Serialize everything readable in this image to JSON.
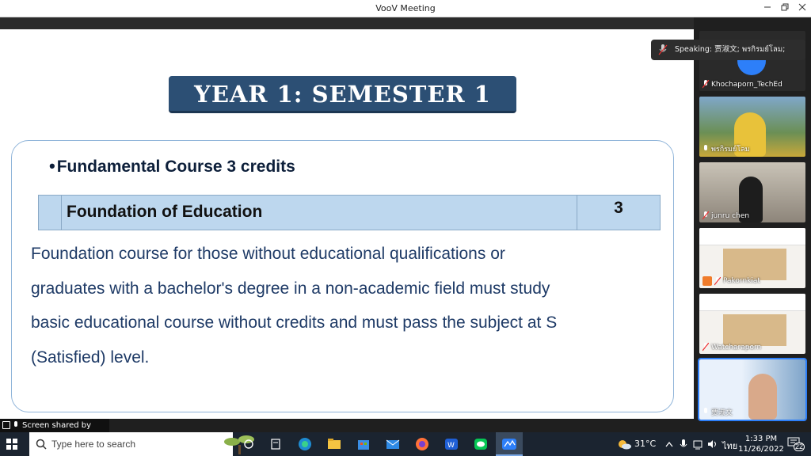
{
  "window": {
    "title": "VooV Meeting"
  },
  "slide": {
    "title": "YEAR 1: SEMESTER 1",
    "bullet": "Fundamental Course 3 credits",
    "course": {
      "name": "Foundation of Education",
      "credits": "3"
    },
    "description_lines": [
      "Foundation course for those without educational qualifications or",
      "graduates with a bachelor's degree in a non-academic field must study",
      "basic educational course without  credits and must pass the subject at S",
      "(Satisfied) level."
    ]
  },
  "speaking_label": "Speaking: 贾淑文; พรกิรมย์โลม;",
  "participants": [
    {
      "name": "Khochaporn_TechEd"
    },
    {
      "name": "พรกิรมย์โลม"
    },
    {
      "name": "junru  chen"
    },
    {
      "name": "Pakornkiat"
    },
    {
      "name": "Watcharaporn"
    },
    {
      "name": "贾淑文"
    }
  ],
  "share_label": "Screen shared by พรก...",
  "taskbar": {
    "search_placeholder": "Type here to search",
    "weather": "31°C",
    "lang": "ไทย",
    "time": "1:33 PM",
    "date": "11/26/2022",
    "notification_count": "22"
  }
}
